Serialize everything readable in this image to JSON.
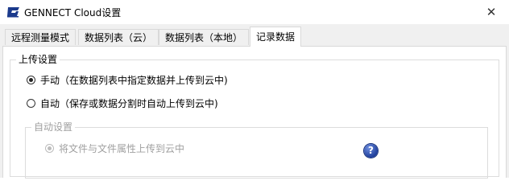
{
  "window": {
    "title": "GENNECT Cloud设置",
    "close_glyph": "✕"
  },
  "tabs": [
    {
      "label": "远程测量模式"
    },
    {
      "label": "数据列表（云）"
    },
    {
      "label": "数据列表（本地）"
    },
    {
      "label": "记录数据"
    }
  ],
  "upload_settings": {
    "label": "上传设置",
    "options": [
      {
        "label": "手动（在数据列表中指定数据并上传到云中)",
        "checked": true
      },
      {
        "label": "自动（保存或数据分割时自动上传到云中)",
        "checked": false
      }
    ]
  },
  "auto_settings": {
    "label": "自动设置",
    "option": {
      "label": "将文件与文件属性上传到云中",
      "checked": true,
      "enabled": false
    }
  },
  "help": {
    "glyph": "?"
  },
  "colors": {
    "accent_help": "#1f3f9c",
    "disabled": "#a0a0a0"
  }
}
